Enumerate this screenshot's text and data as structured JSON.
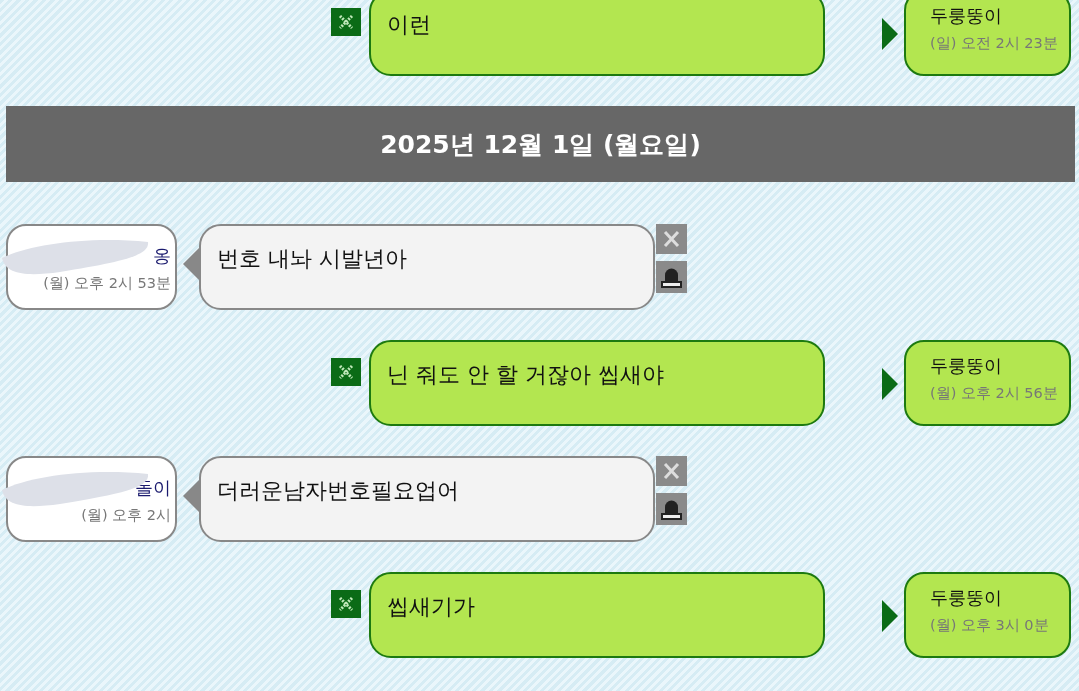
{
  "messages": [
    {
      "kind": "outgoing",
      "text": "이런",
      "sender": "두룽뚱이",
      "time": "(일) 오전 2시 23분"
    },
    {
      "kind": "date",
      "text": "2025년 12월 1일 (월요일)"
    },
    {
      "kind": "incoming",
      "text": "번호 내놔 시발년아",
      "sender": "옹",
      "time": "(월) 오후 2시 53분",
      "redacted": true
    },
    {
      "kind": "outgoing",
      "text": "닌 줘도 안 할 거잖아 씹새야",
      "sender": "두룽뚱이",
      "time": "(월) 오후 2시 56분"
    },
    {
      "kind": "incoming",
      "text": "더러운남자번호필요업어",
      "sender": "돌이",
      "time": "(월) 오후 2시",
      "redacted": true
    },
    {
      "kind": "outgoing",
      "text": "씹새기가",
      "sender": "두룽뚱이",
      "time": "(월) 오후 3시 0분"
    }
  ]
}
